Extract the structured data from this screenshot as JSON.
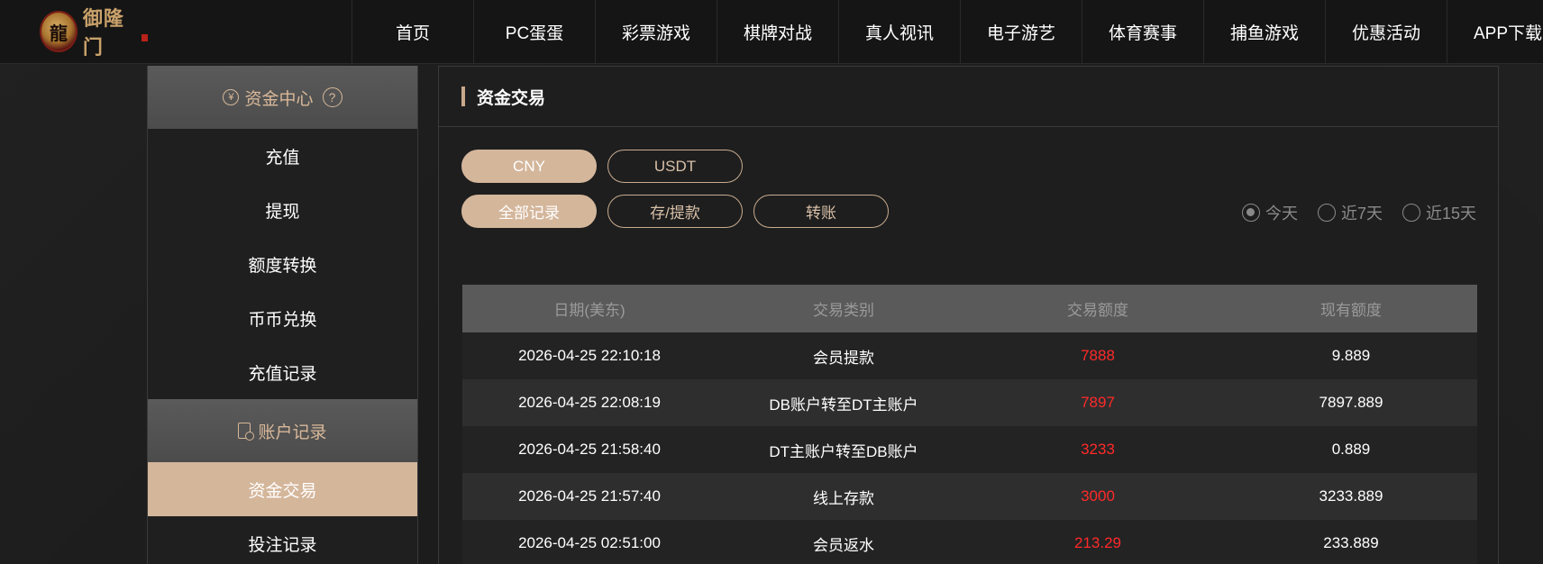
{
  "header": {
    "logo_text": "御隆门",
    "nav": [
      {
        "label": "首页",
        "w": 135
      },
      {
        "label": "PC蛋蛋",
        "w": 135
      },
      {
        "label": "彩票游戏",
        "w": 135
      },
      {
        "label": "棋牌对战",
        "w": 135
      },
      {
        "label": "真人视讯",
        "w": 135
      },
      {
        "label": "电子游艺",
        "w": 135
      },
      {
        "label": "体育赛事",
        "w": 135
      },
      {
        "label": "捕鱼游戏",
        "w": 135
      },
      {
        "label": "优惠活动",
        "w": 135
      },
      {
        "label": "APP下载",
        "w": 135
      }
    ]
  },
  "sidebar": {
    "fund_center": {
      "label": "资金中心",
      "icon": "yen-icon",
      "help": "?"
    },
    "fund_items": [
      "充值",
      "提现",
      "额度转换",
      "币币兑换",
      "充值记录"
    ],
    "account_records": {
      "label": "账户记录",
      "icon": "document-icon"
    },
    "record_items": [
      {
        "label": "资金交易",
        "active": true
      },
      {
        "label": "投注记录",
        "active": false
      }
    ]
  },
  "main": {
    "title": "资金交易",
    "currency_tabs": [
      {
        "label": "CNY",
        "active": true
      },
      {
        "label": "USDT",
        "active": false
      }
    ],
    "type_tabs": [
      {
        "label": "全部记录",
        "active": true
      },
      {
        "label": "存/提款",
        "active": false
      },
      {
        "label": "转账",
        "active": false
      }
    ],
    "date_filters": [
      {
        "label": "今天",
        "selected": true
      },
      {
        "label": "近7天",
        "selected": false
      },
      {
        "label": "近15天",
        "selected": false
      }
    ],
    "table": {
      "headers": [
        "日期(美东)",
        "交易类别",
        "交易额度",
        "现有额度"
      ],
      "rows": [
        [
          "2026-04-25 22:10:18",
          "会员提款",
          "7888",
          "9.889"
        ],
        [
          "2026-04-25 22:08:19",
          "DB账户转至DT主账户",
          "7897",
          "7897.889"
        ],
        [
          "2026-04-25 21:58:40",
          "DT主账户转至DB账户",
          "3233",
          "0.889"
        ],
        [
          "2026-04-25 21:57:40",
          "线上存款",
          "3000",
          "3233.889"
        ],
        [
          "2026-04-25 02:51:00",
          "会员返水",
          "213.29",
          "233.889"
        ]
      ]
    },
    "colors": {
      "accent": "#d4b69b",
      "amount": "#ff2a2a"
    }
  }
}
